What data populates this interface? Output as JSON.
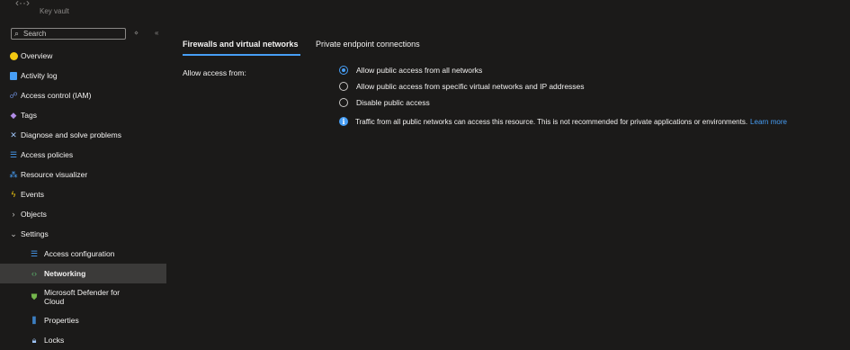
{
  "app": {
    "subtitle": "Key vault"
  },
  "search": {
    "placeholder": "Search",
    "ctl1": "⋄",
    "ctl2": "«"
  },
  "sidebar": {
    "items": [
      {
        "label": "Overview"
      },
      {
        "label": "Activity log"
      },
      {
        "label": "Access control (IAM)"
      },
      {
        "label": "Tags"
      },
      {
        "label": "Diagnose and solve problems"
      },
      {
        "label": "Access policies"
      },
      {
        "label": "Resource visualizer"
      },
      {
        "label": "Events"
      },
      {
        "label": "Objects"
      },
      {
        "label": "Settings"
      },
      {
        "label": "Access configuration"
      },
      {
        "label": "Networking"
      },
      {
        "label": "Microsoft Defender for",
        "label2": "Cloud"
      },
      {
        "label": "Properties"
      },
      {
        "label": "Locks"
      }
    ]
  },
  "tabs": [
    {
      "label": "Firewalls and virtual networks"
    },
    {
      "label": "Private endpoint connections"
    }
  ],
  "form": {
    "allow_label": "Allow access from:",
    "options": [
      {
        "label": "Allow public access from all networks",
        "checked": true
      },
      {
        "label": "Allow public access from specific virtual networks and IP addresses",
        "checked": false
      },
      {
        "label": "Disable public access",
        "checked": false
      }
    ],
    "info_text": "Traffic from all public networks can access this resource. This is not recommended for private applications or environments.",
    "learn_more": "Learn more"
  },
  "colors": {
    "background": "#1b1a19",
    "accent": "#479ef5",
    "active_row": "#3b3a39"
  }
}
